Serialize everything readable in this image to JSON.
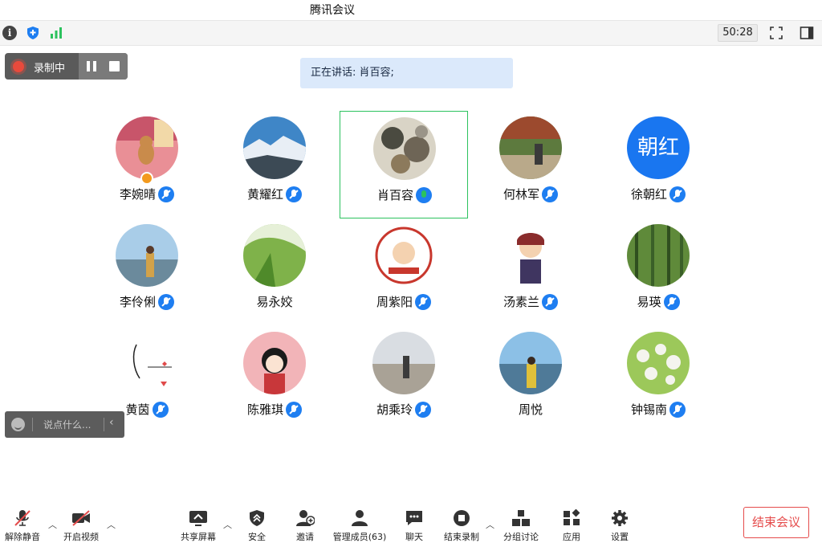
{
  "window": {
    "title": "腾讯会议"
  },
  "topbar": {
    "timer": "50:28"
  },
  "recording": {
    "label": "录制中"
  },
  "speaking": {
    "text": "正在讲话: 肖百容;"
  },
  "participants": [
    {
      "name": "李婉晴",
      "muted": true,
      "host": true
    },
    {
      "name": "黄耀红",
      "muted": true
    },
    {
      "name": "肖百容",
      "muted": false,
      "speaking": true
    },
    {
      "name": "何林军",
      "muted": true
    },
    {
      "name": "徐朝红",
      "muted": true,
      "avatar_text": "朝红"
    },
    {
      "name": "李伶俐",
      "muted": true
    },
    {
      "name": "易永姣",
      "muted": false
    },
    {
      "name": "周紫阳",
      "muted": true
    },
    {
      "name": "汤素兰",
      "muted": true
    },
    {
      "name": "易瑛",
      "muted": true
    },
    {
      "name": "黄茵",
      "muted": true
    },
    {
      "name": "陈雅琪",
      "muted": true
    },
    {
      "name": "胡乘玲",
      "muted": true
    },
    {
      "name": "周悦",
      "muted": false
    },
    {
      "name": "钟锡南",
      "muted": true
    }
  ],
  "chat": {
    "placeholder": "说点什么..."
  },
  "toolbar": {
    "unmute": "解除静音",
    "start_video": "开启视频",
    "share_screen": "共享屏幕",
    "security": "安全",
    "invite": "邀请",
    "manage_members": "管理成员(63)",
    "chat": "聊天",
    "end_recording": "结束录制",
    "breakout": "分组讨论",
    "apps": "应用",
    "settings": "设置",
    "end_meeting": "结束会议"
  },
  "colors": {
    "accent": "#1e7ef1",
    "speaking_border": "#2cc25e",
    "end_red": "#e54c4c"
  }
}
